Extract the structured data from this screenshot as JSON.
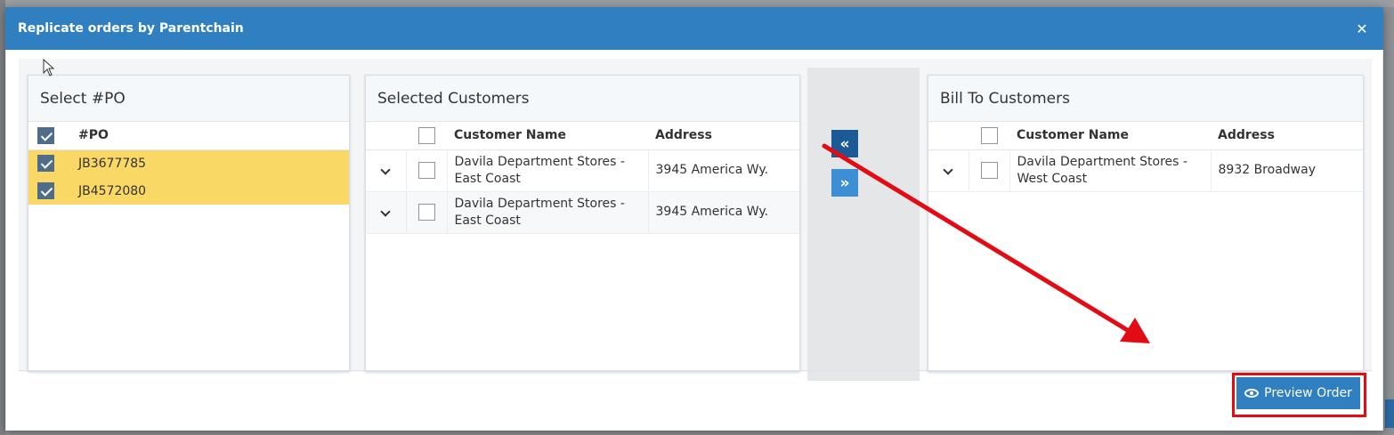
{
  "modal": {
    "title": "Replicate orders by Parentchain",
    "close_glyph": "✕"
  },
  "po_panel": {
    "title": "Select #PO",
    "header": "#PO",
    "rows": [
      {
        "po": "JB3677785",
        "checked": true
      },
      {
        "po": "JB4572080",
        "checked": true
      }
    ]
  },
  "selected_customers": {
    "title": "Selected Customers",
    "columns": [
      "Customer Name",
      "Address"
    ],
    "rows": [
      {
        "name": "Davila Department Stores - East Coast",
        "address": "3945 America Wy."
      },
      {
        "name": "Davila Department Stores - East Coast",
        "address": "3945 America Wy."
      }
    ]
  },
  "bill_to_customers": {
    "title": "Bill To Customers",
    "columns": [
      "Customer Name",
      "Address"
    ],
    "rows": [
      {
        "name": "Davila Department Stores - West Coast",
        "address": "8932 Broadway"
      }
    ]
  },
  "move_buttons": {
    "left_glyph": "«",
    "right_glyph": "»"
  },
  "footer": {
    "preview_label": "Preview Order"
  },
  "colors": {
    "header_blue": "#2f7fc1",
    "selected_row": "#f9d865",
    "annotation_red": "#e30b14"
  }
}
